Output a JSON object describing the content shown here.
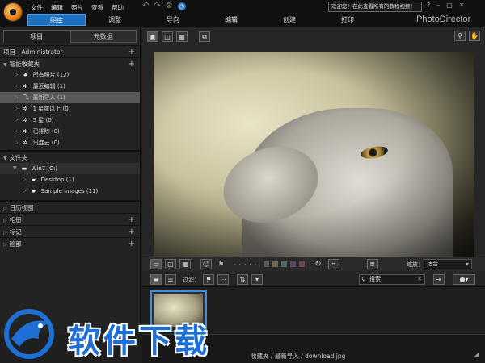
{
  "app": {
    "brand": "PhotoDirector",
    "welcome": "欢迎您！在此查看所有的教程视频！"
  },
  "menu": [
    "文件",
    "编辑",
    "照片",
    "查看",
    "帮助"
  ],
  "modes": [
    {
      "label": "图库",
      "active": true
    },
    {
      "label": "调整"
    },
    {
      "label": "导向"
    },
    {
      "label": "编辑"
    },
    {
      "label": "创建"
    },
    {
      "label": "打印"
    }
  ],
  "window_buttons": [
    "?",
    "–",
    "□",
    "✕"
  ],
  "left_panel": {
    "tabs": [
      "项目",
      "元数据"
    ],
    "project_header": "项目 - Administrator",
    "smart_collections_header": "智能收藏夹",
    "smart_items": [
      {
        "label": "所有照片 (12)"
      },
      {
        "label": "最近编辑 (1)"
      },
      {
        "label": "最新导入 (1)",
        "selected": true
      },
      {
        "label": "1 星或以上 (0)"
      },
      {
        "label": "5 星 (0)"
      },
      {
        "label": "已排除 (0)"
      },
      {
        "label": "讯连云 (0)"
      }
    ],
    "folders_header": "文件夹",
    "folder_root": "Win7 (C:)",
    "folder_items": [
      {
        "label": "Desktop (1)"
      },
      {
        "label": "Sample Images (11)"
      }
    ],
    "sections": [
      "日历视图",
      "相册",
      "标记",
      "脸部"
    ]
  },
  "toolbar": {
    "zoom_label": "缩放：",
    "zoom_value": "适合",
    "filter_label": "过滤：",
    "search_placeholder": "搜索"
  },
  "colors": {
    "accent": "#1d6fc0",
    "thumb_border": "#3f8fe0",
    "watermark": "#1e6fd6",
    "label_swatches": [
      "#5a5a5a",
      "#6b6b4a",
      "#4a6b6b",
      "#5a4a6b",
      "#6b4a4a"
    ]
  },
  "status": {
    "path": "收藏夹 / 最新导入 / download.jpg"
  },
  "watermark": {
    "text": "软件下载"
  }
}
